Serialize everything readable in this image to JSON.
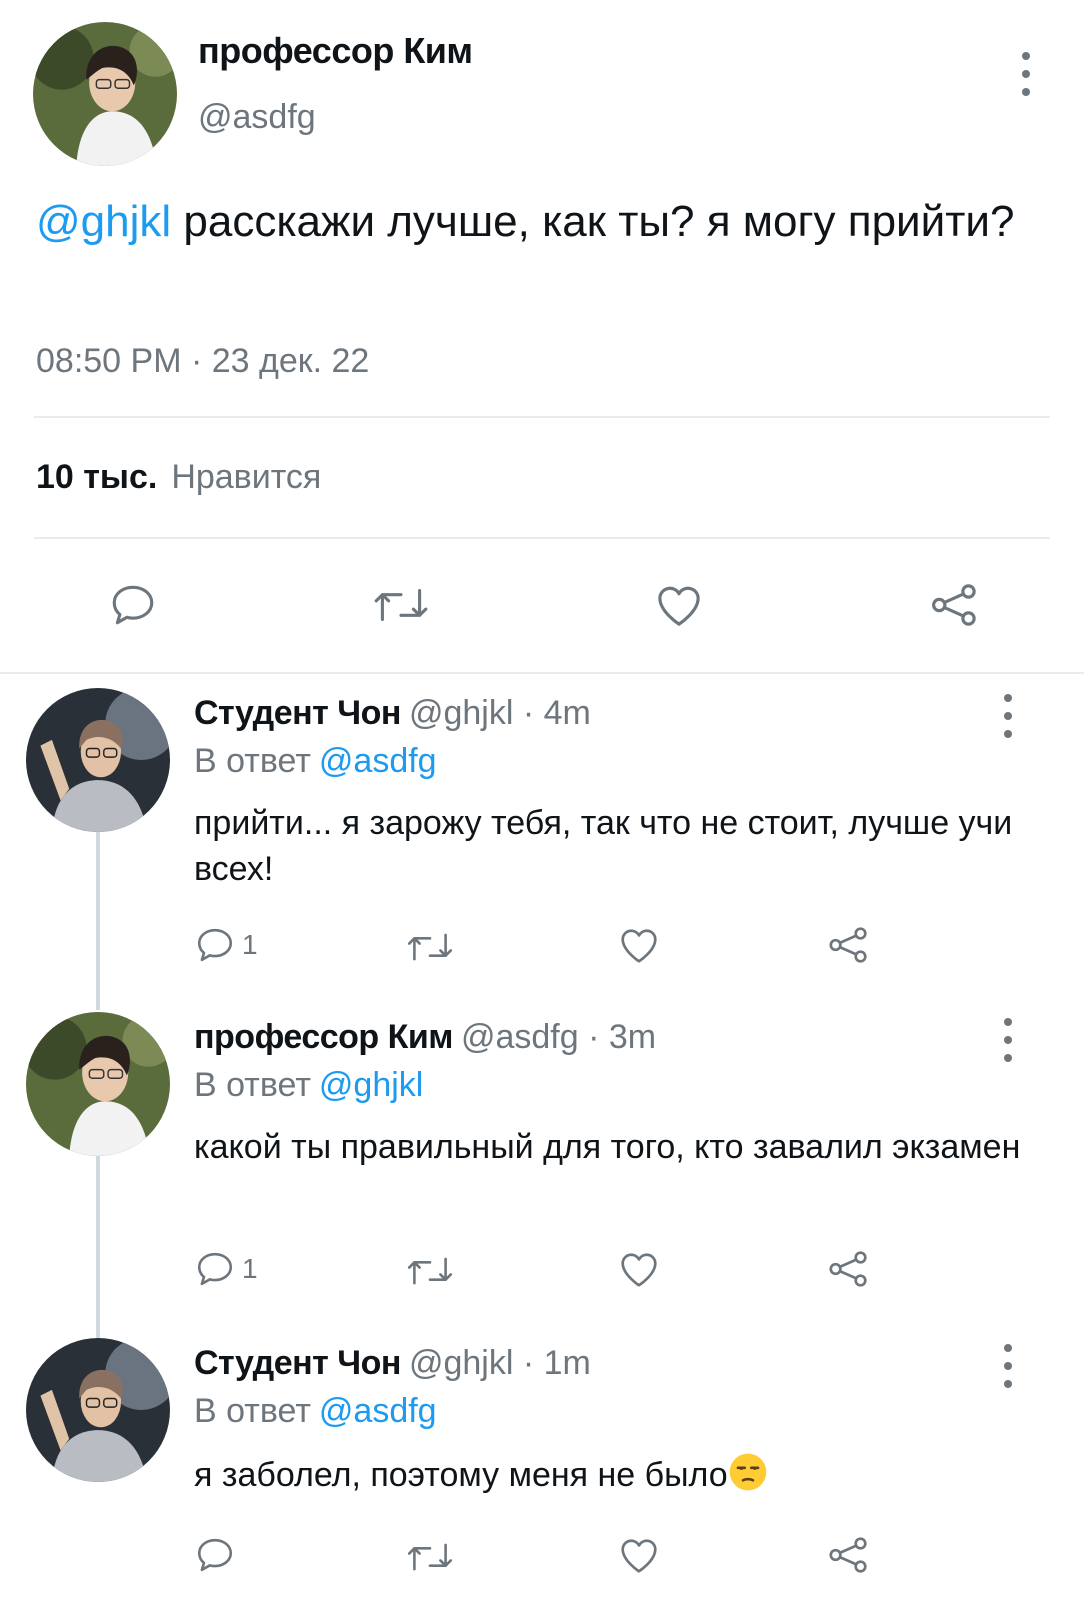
{
  "main_tweet": {
    "author_name": "профессор Ким",
    "author_handle": "@asdfg",
    "mention": "@ghjkl",
    "text": " расскажи лучше, как ты? я могу прийти?",
    "time": "08:50 PM · 23 дек. 22",
    "likes_count": "10 тыс.",
    "likes_label": "Нравится"
  },
  "replies": [
    {
      "author_name": "Студент Чон",
      "meta": "@ghjkl · 4m",
      "reply_to_label": "В ответ",
      "reply_to": "@asdfg",
      "text": "прийти... я зарожу тебя, так что не стоит, лучше учи всех!",
      "reply_count": "1"
    },
    {
      "author_name": "профессор Ким",
      "meta": "@asdfg · 3m",
      "reply_to_label": "В ответ",
      "reply_to": "@ghjkl",
      "text": "какой ты правильный для того, кто завалил экзамен",
      "reply_count": "1"
    },
    {
      "author_name": "Студент Чон",
      "meta": "@ghjkl · 1m",
      "reply_to_label": "В ответ",
      "reply_to": "@asdfg",
      "text": "я заболел, поэтому меня не было",
      "emoji": "unamused-face-emoji"
    }
  ],
  "icons": {
    "reply": "speech-bubble-icon",
    "retweet": "retweet-icon",
    "like": "heart-icon",
    "share": "share-icon",
    "more": "more-vertical-icon"
  },
  "colors": {
    "accent": "#1d9bf0",
    "text": "#0f1419",
    "muted": "#6e767d",
    "divider": "#e6ecf0"
  }
}
